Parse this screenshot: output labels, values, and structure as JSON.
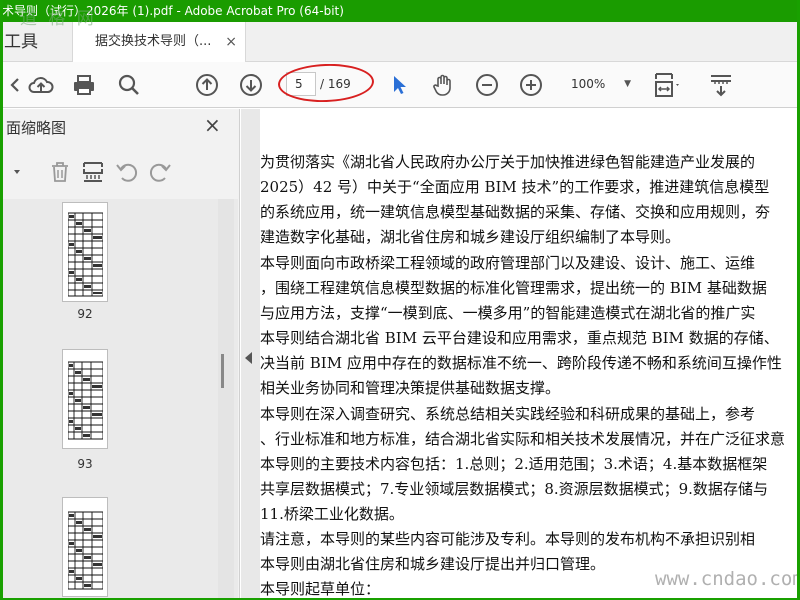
{
  "titlebar": {
    "title": "术导则（试行）2026年 (1).pdf - Adobe Acrobat Pro (64-bit)",
    "watermark": "道 格 网"
  },
  "tabs": {
    "tools_label": "工具",
    "document_label": "据交换技术导则（...",
    "close_glyph": "×"
  },
  "toolbar": {
    "current_page": "5",
    "total_pages": "/ 169",
    "zoom_value": "100%",
    "icons": [
      "back-icon",
      "cloud-upload-icon",
      "print-icon",
      "search-icon",
      "page-up-icon",
      "page-down-icon",
      "select-cursor-icon",
      "hand-tool-icon",
      "zoom-out-icon",
      "zoom-in-icon",
      "page-fit-icon",
      "read-mode-icon"
    ],
    "accent_color": "#2a6fd6",
    "annotation_color": "#d82020"
  },
  "panel": {
    "title": "面缩略图",
    "close_glyph": "×",
    "thumbnails": [
      {
        "page_label": "92"
      },
      {
        "page_label": "93"
      },
      {
        "page_label": ""
      }
    ]
  },
  "document": {
    "paragraphs": [
      "    为贯彻落实《湖北省人民政府办公厅关于加快推进绿色智能建造产业发展的",
      "2025）42 号）中关于“全面应用 BIM 技术”的工作要求，推进建筑信息模型",
      "的系统应用，统一建筑信息模型基础数据的采集、存储、交换和应用规则，夯",
      "建造数字化基础，湖北省住房和城乡建设厅组织编制了本导则。",
      "    本导则面向市政桥梁工程领域的政府管理部门以及建设、设计、施工、运维",
      "，围绕工程建筑信息模型数据的标准化管理需求，提出统一的 BIM 基础数据",
      "与应用方法，支撑“一模到底、一模多用”的智能建造模式在湖北省的推广实",
      "    本导则结合湖北省 BIM 云平台建设和应用需求，重点规范 BIM 数据的存储、",
      "决当前 BIM 应用中存在的数据标准不统一、跨阶段传递不畅和系统间互操作性",
      "相关业务协同和管理决策提供基础数据支撑。",
      "    本导则在深入调查研究、系统总结相关实践经验和科研成果的基础上，参考",
      "、行业标准和地方标准，结合湖北省实际和相关技术发展情况，并在广泛征求意",
      "    本导则的主要技术内容包括：1.总则；2.适用范围；3.术语；4.基本数据框架",
      "共享层数据模式；7.专业领域层数据模式；8.资源层数据模式；9.数据存储与",
      "    11.桥梁工业化数据。",
      "    请注意，本导则的某些内容可能涉及专利。本导则的发布机构不承担识别相",
      "    本导则由湖北省住房和城乡建设厅提出并归口管理。",
      "    本导则起草单位："
    ],
    "watermark": "www.cndao.com"
  }
}
